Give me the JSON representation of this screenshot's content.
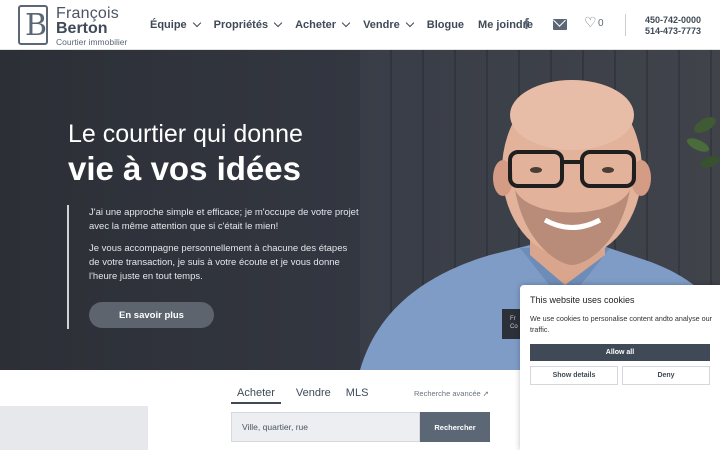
{
  "brand": {
    "first_name": "François",
    "last_name": "Berton",
    "tagline": "Courtier immobilier",
    "logo_letter": "B"
  },
  "nav": {
    "items": [
      {
        "label": "Équipe",
        "has_dropdown": true
      },
      {
        "label": "Propriétés",
        "has_dropdown": true
      },
      {
        "label": "Acheter",
        "has_dropdown": true
      },
      {
        "label": "Vendre",
        "has_dropdown": true
      },
      {
        "label": "Blogue",
        "has_dropdown": false
      },
      {
        "label": "Me joindre",
        "has_dropdown": false
      }
    ]
  },
  "header": {
    "facebook_icon": "facebook-icon",
    "mail_icon": "mail-icon",
    "heart_icon": "heart-icon",
    "favorites_count": "0",
    "phone_1": "450-742-0000",
    "phone_2": "514-473-7773"
  },
  "hero": {
    "line1": "Le courtier qui donne",
    "line2": "vie à vos idées",
    "paragraph1": "J'ai une approche simple et efficace; je m'occupe de votre projet avec la même attention que si c'était le mien!",
    "paragraph2": "Je vous accompagne personnellement à chacune des étapes de votre transaction, je suis à votre écoute et je vous donne l'heure juste en tout temps.",
    "cta_label": "En savoir plus",
    "namecard_line1": "Fr",
    "namecard_line2": "Co"
  },
  "search": {
    "tabs": [
      {
        "label": "Acheter",
        "active": true
      },
      {
        "label": "Vendre",
        "active": false
      },
      {
        "label": "MLS",
        "active": false
      }
    ],
    "advanced_label": "Recherche avancée ➚",
    "placeholder": "Ville, quartier, rue",
    "button_label": "Rechercher"
  },
  "cookie": {
    "title": "This website uses cookies",
    "text": "We use cookies to personalise content andto analyse our traffic.",
    "allow_label": "Allow all",
    "details_label": "Show details",
    "deny_label": "Deny"
  },
  "colors": {
    "brand_dark": "#3f4a56",
    "hero_bg": "#2e323a",
    "button_gray": "#5d646e",
    "shirt_blue": "#7e9cc6"
  }
}
